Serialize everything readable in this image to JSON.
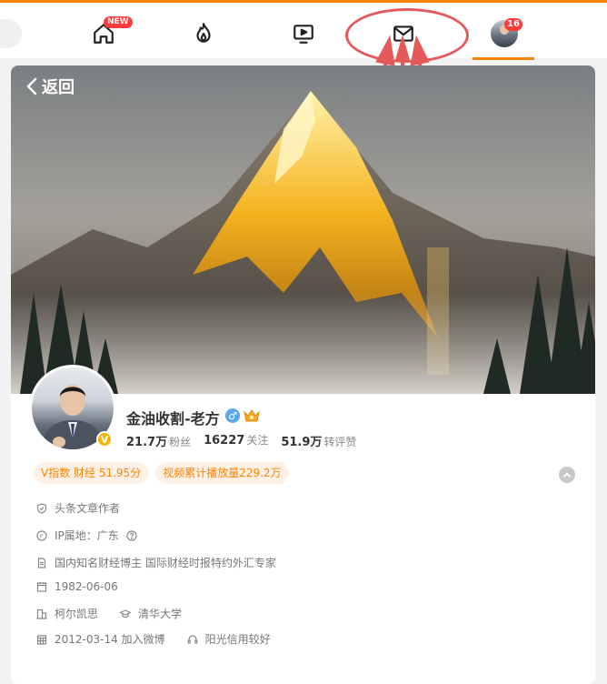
{
  "topnav": {
    "home_badge": "NEW",
    "avatar_badge": "16"
  },
  "profile": {
    "back_label": "返回",
    "username": "金油收割-老方",
    "verified_mark": "V",
    "gender_symbol": "♂",
    "stats": [
      {
        "value": "21.7万",
        "label": "粉丝"
      },
      {
        "value": "16227",
        "label": "关注"
      },
      {
        "value": "51.9万",
        "label": "转评赞"
      }
    ],
    "tags": [
      "V指数 财经 51.95分",
      "视频累计播放量229.2万"
    ],
    "info": {
      "role": "头条文章作者",
      "ip": "IP属地：广东",
      "bio": "国内知名财经博主 国际财经时报特约外汇专家",
      "birthday": "1982-06-06",
      "company": "柯尔凯思",
      "school": "清华大学",
      "joined": "2012-03-14 加入微博",
      "credit": "阳光信用较好"
    }
  },
  "colors": {
    "accent": "#ff8200",
    "badge": "#ff3b3b",
    "callout": "#e45a5a",
    "tag_bg": "#fff1e6"
  }
}
